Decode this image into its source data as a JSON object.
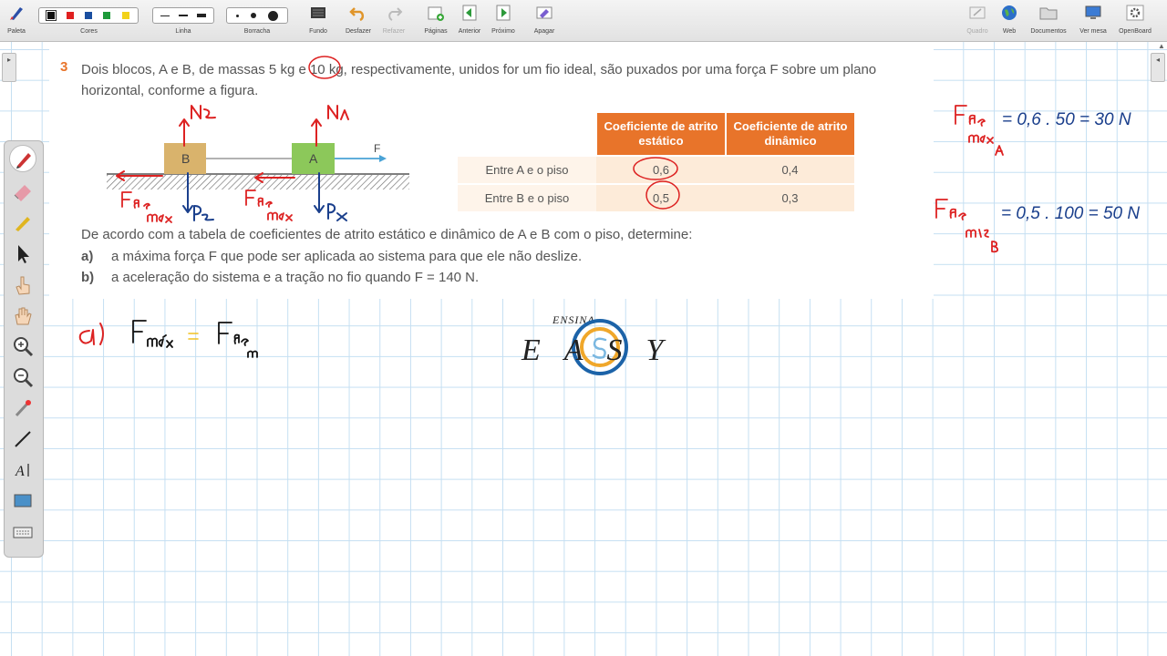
{
  "toolbar": {
    "items": [
      {
        "label": "Paleta",
        "icon": "palette-icon"
      },
      {
        "label": "Cores",
        "icon": "colors-icon"
      },
      {
        "label": "Linha",
        "icon": "line-width-icon"
      },
      {
        "label": "Borracha",
        "icon": "eraser-size-icon"
      },
      {
        "label": "Fundo",
        "icon": "background-icon"
      },
      {
        "label": "Desfazer",
        "icon": "undo-icon"
      },
      {
        "label": "Refazer",
        "icon": "redo-icon"
      },
      {
        "label": "Páginas",
        "icon": "pages-icon"
      },
      {
        "label": "Anterior",
        "icon": "previous-page-icon"
      },
      {
        "label": "Próximo",
        "icon": "next-page-icon"
      },
      {
        "label": "Apagar",
        "icon": "clear-page-icon"
      },
      {
        "label": "Quadro",
        "icon": "board-icon"
      },
      {
        "label": "Web",
        "icon": "web-globe-icon"
      },
      {
        "label": "Documentos",
        "icon": "documents-folder-icon"
      },
      {
        "label": "Ver mesa",
        "icon": "desktop-icon"
      },
      {
        "label": "OpenBoard",
        "icon": "openboard-settings-icon"
      }
    ],
    "colors": [
      "#111111",
      "#e02020",
      "#1a4fa0",
      "#1e9a3a",
      "#f2d21a"
    ]
  },
  "question": {
    "number": "3",
    "text": "Dois blocos, A e B, de massas 5 kg e 10 kg, respectivamente, unidos for um fio ideal, são puxados por uma força F sobre um plano horizontal, conforme a figura.",
    "instruction": "De acordo com a tabela de coeficientes de atrito estático e dinâmico de A e B com o piso, determine:",
    "items": [
      {
        "letter": "a)",
        "text": "a máxima força F que pode ser aplicada ao sistema para que ele não deslize."
      },
      {
        "letter": "b)",
        "text": "a aceleração do sistema e a tração no fio quando F = 140 N."
      }
    ]
  },
  "figure": {
    "block_b": "B",
    "block_a": "A",
    "force_label": "F"
  },
  "table": {
    "headers": [
      "Coeficiente de atrito estático",
      "Coeficiente de atrito dinâmico"
    ],
    "rows": [
      {
        "label": "Entre A e o piso",
        "static": "0,6",
        "dynamic": "0,4"
      },
      {
        "label": "Entre B e o piso",
        "static": "0,5",
        "dynamic": "0,3"
      }
    ]
  },
  "handwriting": {
    "eq1": "= 0,6 . 50 = 30 N",
    "eq2": "= 0,5 . 100 = 50 N",
    "fa": "Fa",
    "part_a": "a)",
    "fmax": "Fmáx = Fa"
  },
  "logo": {
    "top": "ENSINA",
    "letters": "EASY"
  }
}
